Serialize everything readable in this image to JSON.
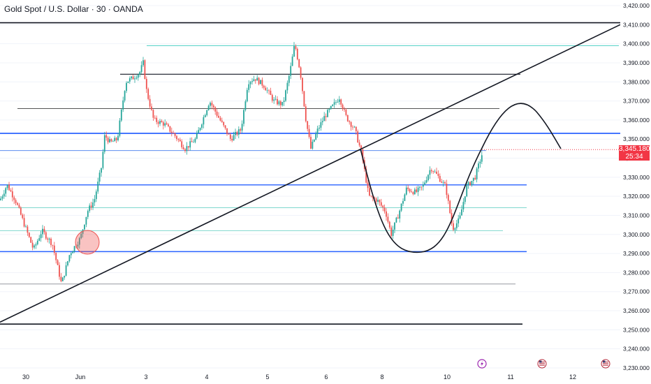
{
  "title": "Gold Spot / U.S. Dollar · 30 · OANDA",
  "last_price": "3,345.180",
  "countdown": "25:34",
  "colors": {
    "up": "#26a69a",
    "down": "#ef5350",
    "support_blue": "#2962ff",
    "teal": "#4dd0c4",
    "badge": "#f23645"
  },
  "x_axis": {
    "labels": [
      "30",
      "Jun",
      "3",
      "4",
      "5",
      "6",
      "8",
      "10",
      "11",
      "12"
    ]
  },
  "y_axis": {
    "labels": [
      "3,420.000",
      "3,410.000",
      "3,400.000",
      "3,390.000",
      "3,380.000",
      "3,370.000",
      "3,360.000",
      "3,350.000",
      "3,340.000",
      "3,330.000",
      "3,320.000",
      "3,310.000",
      "3,300.000",
      "3,290.000",
      "3,280.000",
      "3,270.000",
      "3,260.000",
      "3,250.000",
      "3,240.000",
      "3,230.000"
    ]
  },
  "event_icons": [
    "lightning-icon",
    "us-flag-icon",
    "us-flag-icon"
  ],
  "chart_data": {
    "type": "candlestick",
    "title": "Gold Spot / U.S. Dollar · 30 · OANDA",
    "ylim": [
      3230,
      3420
    ],
    "price_path": [
      [
        0,
        3318
      ],
      [
        10,
        3326
      ],
      [
        22,
        3318
      ],
      [
        35,
        3305
      ],
      [
        48,
        3292
      ],
      [
        60,
        3302
      ],
      [
        75,
        3295
      ],
      [
        88,
        3274
      ],
      [
        100,
        3290
      ],
      [
        115,
        3298
      ],
      [
        125,
        3312
      ],
      [
        135,
        3318
      ],
      [
        145,
        3335
      ],
      [
        150,
        3352
      ],
      [
        158,
        3348
      ],
      [
        168,
        3350
      ],
      [
        180,
        3380
      ],
      [
        190,
        3382
      ],
      [
        200,
        3385
      ],
      [
        205,
        3390
      ],
      [
        210,
        3375
      ],
      [
        220,
        3360
      ],
      [
        235,
        3358
      ],
      [
        250,
        3352
      ],
      [
        265,
        3345
      ],
      [
        280,
        3350
      ],
      [
        300,
        3370
      ],
      [
        315,
        3360
      ],
      [
        330,
        3350
      ],
      [
        345,
        3355
      ],
      [
        355,
        3380
      ],
      [
        365,
        3382
      ],
      [
        378,
        3378
      ],
      [
        392,
        3370
      ],
      [
        405,
        3368
      ],
      [
        415,
        3385
      ],
      [
        422,
        3400
      ],
      [
        430,
        3385
      ],
      [
        438,
        3360
      ],
      [
        445,
        3345
      ],
      [
        455,
        3355
      ],
      [
        465,
        3362
      ],
      [
        478,
        3368
      ],
      [
        486,
        3372
      ],
      [
        495,
        3362
      ],
      [
        508,
        3355
      ],
      [
        518,
        3342
      ],
      [
        528,
        3320
      ],
      [
        540,
        3318
      ],
      [
        552,
        3312
      ],
      [
        560,
        3300
      ],
      [
        570,
        3310
      ],
      [
        582,
        3324
      ],
      [
        595,
        3322
      ],
      [
        605,
        3325
      ],
      [
        617,
        3335
      ],
      [
        628,
        3330
      ],
      [
        638,
        3325
      ],
      [
        648,
        3303
      ],
      [
        658,
        3308
      ],
      [
        668,
        3325
      ],
      [
        680,
        3330
      ],
      [
        690,
        3342
      ]
    ],
    "horizontal_levels": [
      {
        "price": 3411,
        "style": "black-thick"
      },
      {
        "price": 3399,
        "style": "teal"
      },
      {
        "price": 3384,
        "style": "black"
      },
      {
        "price": 3366,
        "style": "gray-dark"
      },
      {
        "price": 3353,
        "style": "blue-thick"
      },
      {
        "price": 3344,
        "style": "blue-thin"
      },
      {
        "price": 3326,
        "style": "blue"
      },
      {
        "price": 3314,
        "style": "teal-light"
      },
      {
        "price": 3302,
        "style": "teal-light"
      },
      {
        "price": 3291,
        "style": "blue"
      },
      {
        "price": 3274,
        "style": "gray"
      },
      {
        "price": 3253,
        "style": "black-thick"
      }
    ],
    "trendline": {
      "from_price": 3254,
      "to_price": 3410
    },
    "projection": "arc down then up then down",
    "marker": "circle at recent low"
  }
}
